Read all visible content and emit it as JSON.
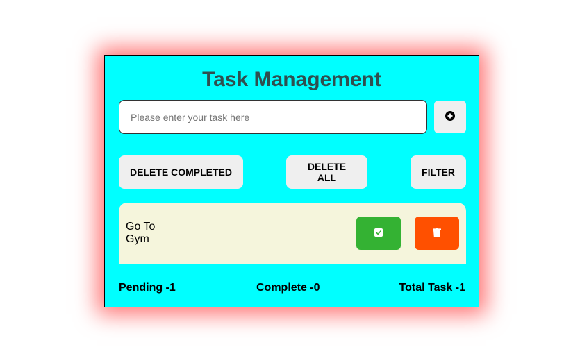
{
  "header": {
    "title": "Task Management"
  },
  "input": {
    "placeholder": "Please enter your task here",
    "value": ""
  },
  "icons": {
    "add": "plus-circle-icon",
    "complete": "check-square-icon",
    "delete": "trash-icon"
  },
  "actions": {
    "delete_completed": "DELETE COMPLETED",
    "delete_all": "DELETE ALL",
    "filter": "FILTER"
  },
  "tasks": [
    {
      "text": "Go To Gym"
    }
  ],
  "footer": {
    "pending": "Pending -1",
    "complete": "Complete -0",
    "total": "Total Task -1"
  },
  "colors": {
    "card_bg": "#00ffff",
    "title": "#2f4f4f",
    "task_bg": "#f5f5dc",
    "complete_btn": "#34b233",
    "delete_btn": "#ff5000",
    "button_bg": "#efefef"
  }
}
